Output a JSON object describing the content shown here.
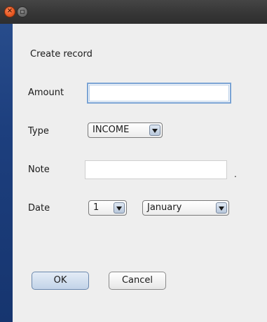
{
  "window": {
    "title": "",
    "close_icon": "close-icon",
    "minimize_icon": "minimize-icon"
  },
  "dialog": {
    "heading": "Create record",
    "amount": {
      "label": "Amount",
      "value": "",
      "placeholder": ""
    },
    "type": {
      "label": "Type",
      "selected": "INCOME"
    },
    "note": {
      "label": "Note",
      "value": "",
      "placeholder": "",
      "trailing": "."
    },
    "date": {
      "label": "Date",
      "day": "1",
      "month": "January"
    },
    "buttons": {
      "ok": "OK",
      "cancel": "Cancel"
    }
  },
  "colors": {
    "desktop": "#1d3f7e",
    "titlebar": "#3a3a3a",
    "close": "#ea5a24",
    "dialog_bg": "#eeeeee",
    "focus_border": "#7aa3d4"
  }
}
